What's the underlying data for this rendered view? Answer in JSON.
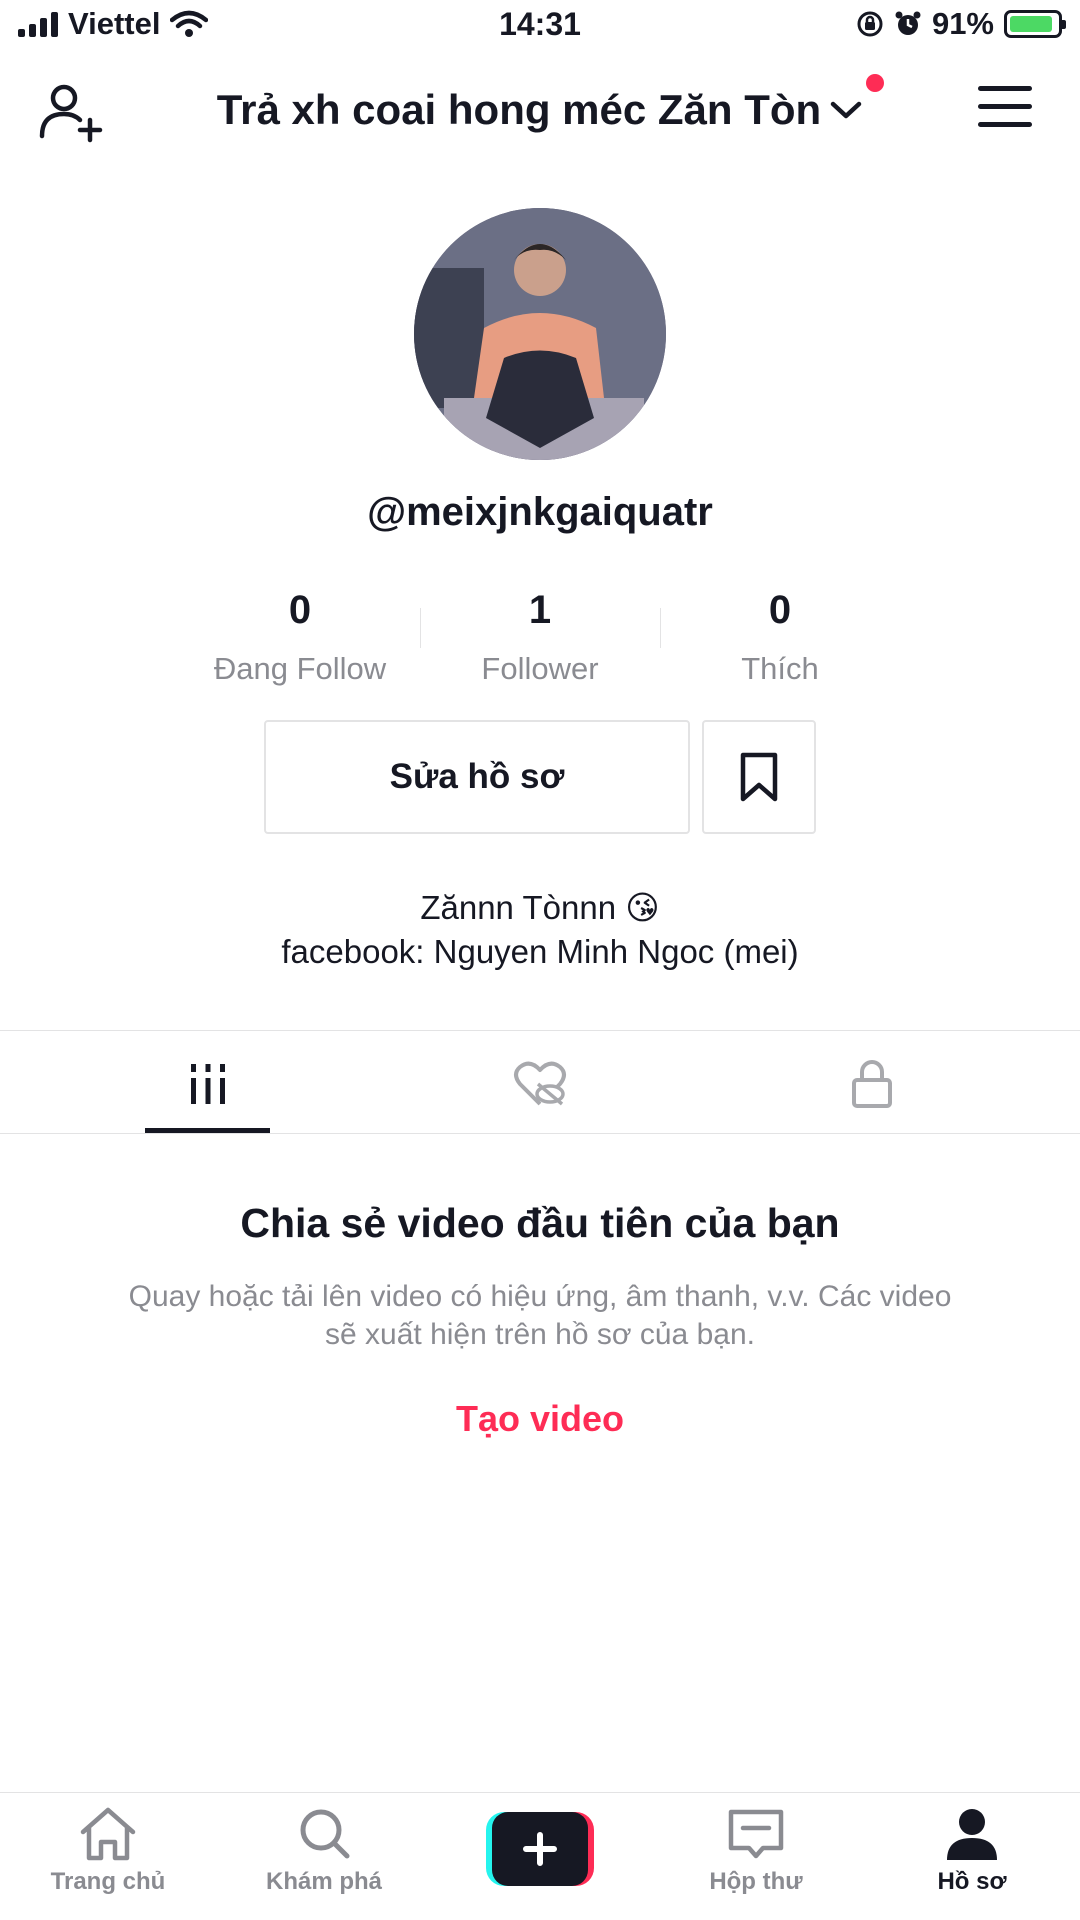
{
  "status_bar": {
    "carrier": "Viettel",
    "time": "14:31",
    "battery_percent": "91%",
    "battery_level": 0.91,
    "battery_color": "#4cd964"
  },
  "header": {
    "title": "Trả xh coai hong méc Zăn Tòn",
    "add_user_icon": "person-plus-icon",
    "chevron_icon": "chevron-down-icon",
    "menu_icon": "hamburger-menu-icon",
    "notification_dot_color": "#fe2c55"
  },
  "profile": {
    "username": "@meixjnkgaiquatr",
    "stats": [
      {
        "value": "0",
        "label": "Đang Follow"
      },
      {
        "value": "1",
        "label": "Follower"
      },
      {
        "value": "0",
        "label": "Thích"
      }
    ],
    "edit_button": "Sửa hồ sơ",
    "bookmark_icon": "bookmark-icon",
    "bio_line1": "Zănnn Tònnn 😘",
    "bio_line2": "facebook: Nguyen Minh Ngoc (mei)"
  },
  "tabs": [
    {
      "icon": "videos-grid-icon",
      "active": true
    },
    {
      "icon": "liked-hidden-icon",
      "active": false
    },
    {
      "icon": "lock-icon",
      "active": false
    }
  ],
  "empty_state": {
    "title": "Chia sẻ video đầu tiên của bạn",
    "description": "Quay hoặc tải lên video có hiệu ứng, âm thanh, v.v. Các video sẽ xuất hiện trên hồ sơ của bạn.",
    "action": "Tạo video",
    "action_color": "#fe2c55"
  },
  "bottom_nav": [
    {
      "label": "Trang chủ",
      "icon": "home-icon"
    },
    {
      "label": "Khám phá",
      "icon": "search-icon"
    },
    {
      "label": "",
      "icon": "plus-icon"
    },
    {
      "label": "Hộp thư",
      "icon": "inbox-icon"
    },
    {
      "label": "Hồ sơ",
      "icon": "profile-icon",
      "active": true
    }
  ]
}
